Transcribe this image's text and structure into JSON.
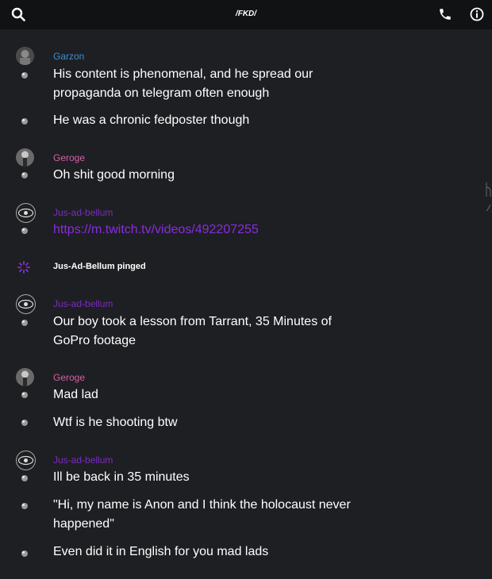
{
  "header": {
    "title": "/FKD/"
  },
  "icons": {
    "search": "search-icon",
    "call": "phone-icon",
    "info": "info-icon"
  },
  "colors": {
    "garzon": "#3a8fd4",
    "geroge": "#d45fa8",
    "jus": "#7a2bc2",
    "link": "#8a2be2",
    "ping_icon": "#8a2be2"
  },
  "messages": [
    {
      "user": "Garzon",
      "lines": [
        "His content is phenomenal, and he spread our propaganda on telegram often enough",
        "He was a chronic fedposter though"
      ]
    },
    {
      "user": "Geroge",
      "lines": [
        "Oh shit good morning"
      ]
    },
    {
      "user": "Jus-ad-bellum",
      "lines": [
        "https://m.twitch.tv/videos/492207255"
      ]
    },
    {
      "ping": {
        "user": "Jus-Ad-Bellum",
        "action": "pinged"
      }
    },
    {
      "user": "Jus-ad-bellum",
      "lines": [
        "Our boy took a lesson from Tarrant, 35 Minutes of GoPro footage"
      ]
    },
    {
      "user": "Geroge",
      "lines": [
        "Mad lad",
        "Wtf is he shooting btw"
      ]
    },
    {
      "user": "Jus-ad-bellum",
      "lines": [
        "Ill be back in 35 minutes",
        "\"Hi, my name is Anon and I think the holocaust never happened\"",
        "Even did it in English for you mad lads"
      ]
    }
  ]
}
